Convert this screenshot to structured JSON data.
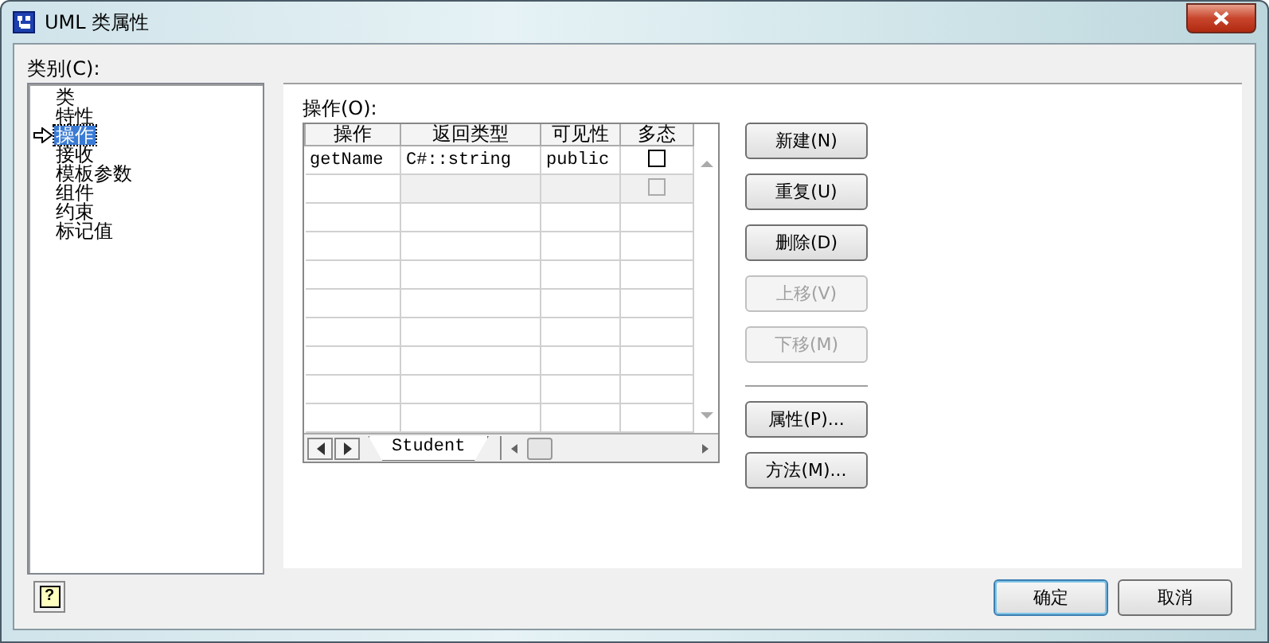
{
  "window": {
    "title": "UML 类属性"
  },
  "category": {
    "label": "类别(C):",
    "items": [
      {
        "label": "类",
        "selected": false
      },
      {
        "label": "特性",
        "selected": false
      },
      {
        "label": "操作",
        "selected": true
      },
      {
        "label": "接收",
        "selected": false
      },
      {
        "label": "模板参数",
        "selected": false
      },
      {
        "label": "组件",
        "selected": false
      },
      {
        "label": "约束",
        "selected": false
      },
      {
        "label": "标记值",
        "selected": false
      }
    ]
  },
  "operations": {
    "label": "操作(O):",
    "columns": [
      "操作",
      "返回类型",
      "可见性",
      "多态"
    ],
    "rows": [
      {
        "kind": "item",
        "cells": [
          "getName",
          "C#::string",
          "public"
        ],
        "checked": false
      },
      {
        "kind": "new",
        "checked": false
      }
    ],
    "sheet_tabs": [
      {
        "label": "Student",
        "selected": true
      }
    ]
  },
  "buttons": [
    {
      "label": "新建(N)",
      "disabled": false
    },
    {
      "label": "重复(U)",
      "disabled": false
    },
    {
      "label": "删除(D)",
      "disabled": false
    },
    {
      "label": "上移(V)",
      "disabled": true
    },
    {
      "label": "下移(M)",
      "disabled": true
    }
  ],
  "more_buttons": [
    {
      "label": "属性(P)...",
      "disabled": false
    },
    {
      "label": "方法(M)...",
      "disabled": false
    }
  ],
  "help_button": {
    "label": "?"
  },
  "footer_buttons": [
    {
      "label": "确定",
      "selected": true
    },
    {
      "label": "取消",
      "selected": false
    }
  ]
}
